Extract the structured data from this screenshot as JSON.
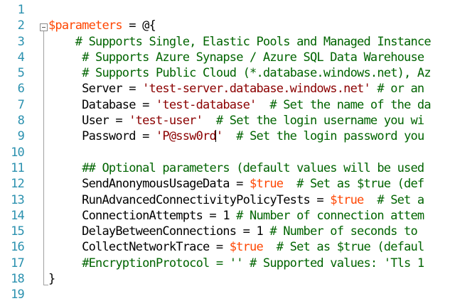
{
  "editor": {
    "line_numbers": [
      "1",
      "2",
      "3",
      "4",
      "5",
      "6",
      "7",
      "8",
      "9",
      "10",
      "11",
      "12",
      "13",
      "14",
      "15",
      "16",
      "17",
      "18",
      "19"
    ],
    "lines": [
      {
        "segments": []
      },
      {
        "segments": [
          {
            "t": "var",
            "text": "$parameters"
          },
          {
            "t": "plain",
            "text": " = @{"
          }
        ]
      },
      {
        "segments": [
          {
            "t": "plain",
            "text": "    "
          },
          {
            "t": "cmt",
            "text": "# Supports Single, Elastic Pools and Managed Instance"
          }
        ]
      },
      {
        "segments": [
          {
            "t": "plain",
            "text": "     "
          },
          {
            "t": "cmt",
            "text": "# Supports Azure Synapse / Azure SQL Data Warehouse"
          }
        ]
      },
      {
        "segments": [
          {
            "t": "plain",
            "text": "     "
          },
          {
            "t": "cmt",
            "text": "# Supports Public Cloud (*.database.windows.net), Az"
          }
        ]
      },
      {
        "segments": [
          {
            "t": "plain",
            "text": "     Server = "
          },
          {
            "t": "str",
            "text": "'test-server.database.windows.net'"
          },
          {
            "t": "cmt",
            "text": " # or an"
          }
        ]
      },
      {
        "segments": [
          {
            "t": "plain",
            "text": "     Database = "
          },
          {
            "t": "str",
            "text": "'test-database'"
          },
          {
            "t": "cmt",
            "text": "  # Set the name of the da"
          }
        ]
      },
      {
        "segments": [
          {
            "t": "plain",
            "text": "     User = "
          },
          {
            "t": "str",
            "text": "'test-user'"
          },
          {
            "t": "cmt",
            "text": "  # Set the login username you wi"
          }
        ]
      },
      {
        "segments": [
          {
            "t": "plain",
            "text": "     Password = "
          },
          {
            "t": "str",
            "text": "'P@ssw0rd"
          },
          {
            "t": "caret",
            "text": ""
          },
          {
            "t": "str",
            "text": "'"
          },
          {
            "t": "cmt",
            "text": "  # Set the login password you"
          }
        ]
      },
      {
        "segments": []
      },
      {
        "segments": [
          {
            "t": "plain",
            "text": "     "
          },
          {
            "t": "cmt",
            "text": "## Optional parameters (default values will be used"
          }
        ]
      },
      {
        "segments": [
          {
            "t": "plain",
            "text": "     SendAnonymousUsageData = "
          },
          {
            "t": "var",
            "text": "$true"
          },
          {
            "t": "cmt",
            "text": "  # Set as $true (def"
          }
        ]
      },
      {
        "segments": [
          {
            "t": "plain",
            "text": "     RunAdvancedConnectivityPolicyTests = "
          },
          {
            "t": "var",
            "text": "$true"
          },
          {
            "t": "cmt",
            "text": "  # Set a"
          }
        ]
      },
      {
        "segments": [
          {
            "t": "plain",
            "text": "     ConnectionAttempts = "
          },
          {
            "t": "plain",
            "text": "1"
          },
          {
            "t": "cmt",
            "text": " # Number of connection attem"
          }
        ]
      },
      {
        "segments": [
          {
            "t": "plain",
            "text": "     DelayBetweenConnections = "
          },
          {
            "t": "plain",
            "text": "1"
          },
          {
            "t": "cmt",
            "text": " # Number of seconds to "
          }
        ]
      },
      {
        "segments": [
          {
            "t": "plain",
            "text": "     CollectNetworkTrace = "
          },
          {
            "t": "var",
            "text": "$true"
          },
          {
            "t": "cmt",
            "text": "  # Set as $true (defaul"
          }
        ]
      },
      {
        "segments": [
          {
            "t": "plain",
            "text": "     "
          },
          {
            "t": "cmt",
            "text": "#EncryptionProtocol = '' # Supported values: 'Tls 1"
          }
        ]
      },
      {
        "segments": [
          {
            "t": "plain",
            "text": "}"
          }
        ]
      },
      {
        "segments": []
      }
    ],
    "colors": {
      "line_number": "#2b91af",
      "variable": "#ff4500",
      "string": "#8b0000",
      "comment": "#006400",
      "text": "#000000",
      "background": "#ffffff"
    }
  }
}
